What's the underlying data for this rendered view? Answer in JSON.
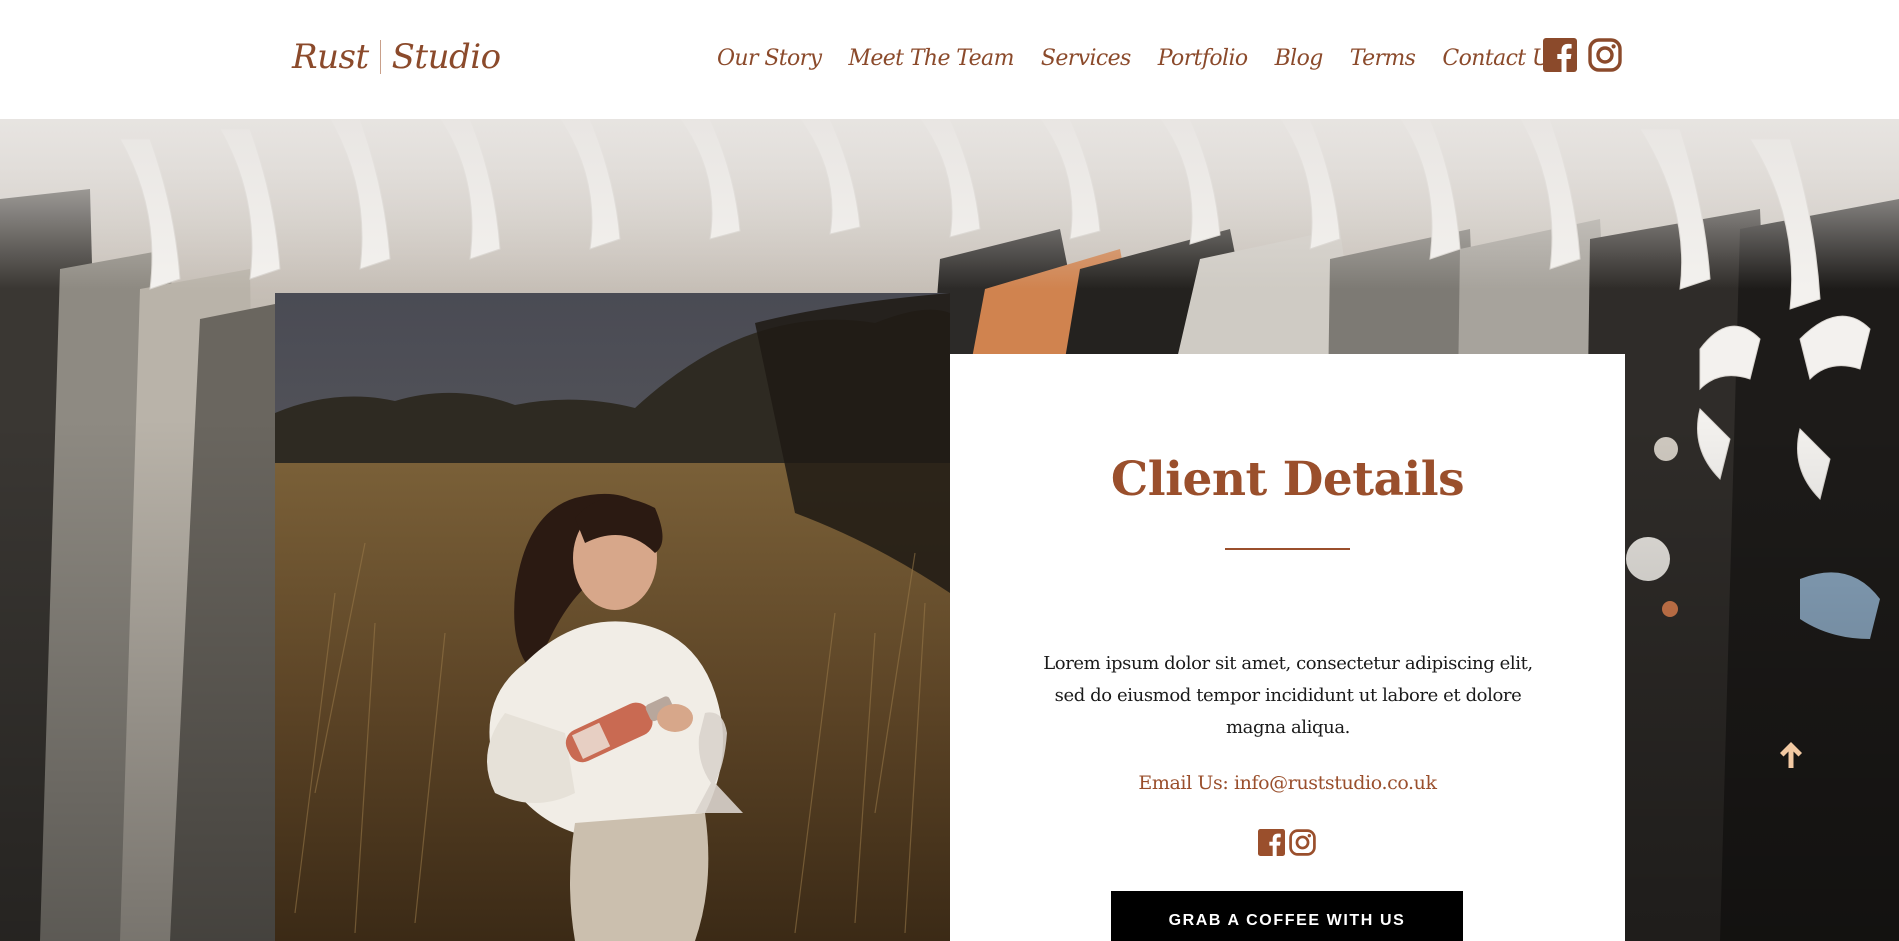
{
  "header": {
    "logo": {
      "left": "Rust",
      "right": "Studio"
    },
    "nav": [
      {
        "label": "Our Story"
      },
      {
        "label": "Meet The Team"
      },
      {
        "label": "Services"
      },
      {
        "label": "Portfolio"
      },
      {
        "label": "Blog"
      },
      {
        "label": "Terms"
      },
      {
        "label": "Contact Us"
      }
    ],
    "social_icons": [
      "facebook-icon",
      "instagram-icon"
    ]
  },
  "card": {
    "title": "Client Details",
    "body": "Lorem ipsum dolor sit amet, consectetur adipiscing elit, sed do eiusmod tempor incididunt ut labore et dolore magna aliqua.",
    "email": "Email Us: info@ruststudio.co.uk",
    "social_icons": [
      "facebook-icon",
      "instagram-icon"
    ],
    "cta_label": "GRAB A COFFEE WITH US"
  },
  "scroll_top_icon": "arrow-up-icon",
  "colors": {
    "brand": "#8b4a2b",
    "accent": "#9a4f2c",
    "cta_background": "#000000",
    "scroll_arrow": "#f2c9a3"
  }
}
